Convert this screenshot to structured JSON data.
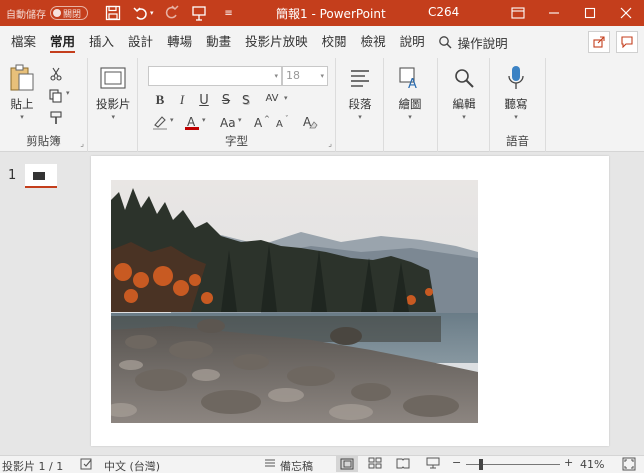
{
  "titlebar": {
    "autosave_label": "自動儲存",
    "autosave_state": "關閉",
    "doc_title": "簡報1  -  PowerPoint",
    "user": "C264",
    "icons": [
      "save-icon",
      "undo-icon",
      "redo-icon",
      "present-icon",
      "customize-icon"
    ],
    "window_controls": [
      "ribbon-display-icon",
      "minimize-icon",
      "maximize-icon",
      "close-icon"
    ]
  },
  "tabs": [
    {
      "label": "檔案"
    },
    {
      "label": "常用",
      "active": true
    },
    {
      "label": "插入"
    },
    {
      "label": "設計"
    },
    {
      "label": "轉場"
    },
    {
      "label": "動畫"
    },
    {
      "label": "投影片放映"
    },
    {
      "label": "校閱"
    },
    {
      "label": "檢視"
    },
    {
      "label": "說明"
    }
  ],
  "search": {
    "label": "操作說明"
  },
  "ribbon": {
    "clipboard": {
      "group_label": "剪貼簿",
      "paste_label": "貼上"
    },
    "slides": {
      "new_slide_label": "投影片"
    },
    "font": {
      "group_label": "字型",
      "font_name_value": "",
      "font_size_value": "18",
      "bold": "B",
      "italic": "I",
      "underline": "U",
      "strike": "S",
      "spacing": "AV",
      "grow": "A",
      "shrink": "A",
      "clear": "A"
    },
    "paragraph": {
      "label": "段落"
    },
    "drawing": {
      "label": "繪圖"
    },
    "editing": {
      "label": "編輯"
    },
    "voice": {
      "label": "聽寫",
      "group_label": "語音"
    }
  },
  "thumbnails": {
    "slide_number": "1"
  },
  "statusbar": {
    "slide_info": "投影片 1 / 1",
    "language": "中文 (台灣)",
    "notes_label": "備忘稿",
    "zoom_minus": "−",
    "zoom_plus": "+",
    "zoom_level": "41%"
  },
  "colors": {
    "accent": "#c43e1c",
    "ribbon_bg": "#f3f3f3",
    "canvas_bg": "#e6e6e6"
  }
}
